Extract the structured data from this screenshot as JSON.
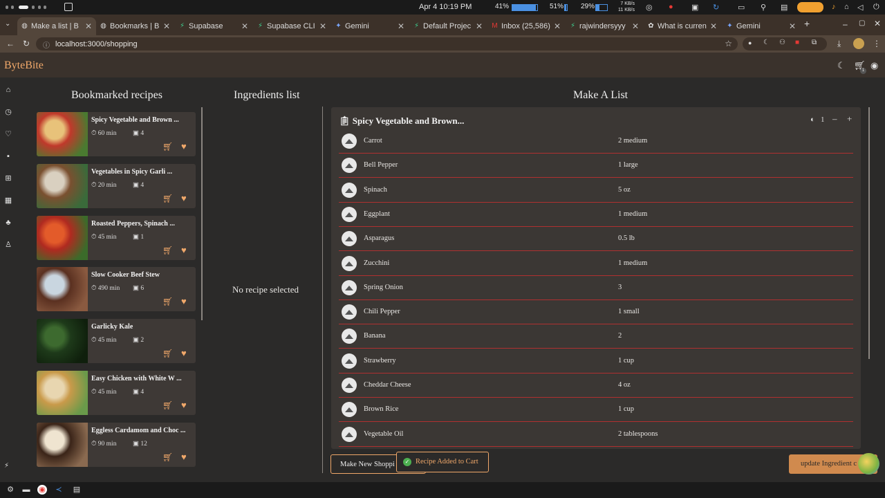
{
  "system": {
    "clock": "Apr 4  10:19 PM",
    "stats": [
      {
        "label": "41%",
        "fill": 0.95
      },
      {
        "label": "51%",
        "fill": 0.5
      },
      {
        "label": "29%",
        "fill": 0.3
      }
    ],
    "net_up": "7 KB/s",
    "net_down": "11 KB/s"
  },
  "tabs": [
    {
      "label": "Make a list | B",
      "icon": "globe-icon",
      "active": true
    },
    {
      "label": "Bookmarks | B",
      "icon": "globe-icon",
      "active": false
    },
    {
      "label": "Supabase",
      "icon": "supabase-icon",
      "active": false
    },
    {
      "label": "Supabase CLI",
      "icon": "supabase-icon",
      "active": false
    },
    {
      "label": "Gemini",
      "icon": "gemini-icon",
      "active": false
    },
    {
      "label": "Default Projec",
      "icon": "supabase-icon",
      "active": false
    },
    {
      "label": "Inbox (25,586)",
      "icon": "gmail-icon",
      "active": false
    },
    {
      "label": "rajwindersyyy",
      "icon": "supabase-icon",
      "active": false
    },
    {
      "label": "What is curren",
      "icon": "chatgpt-icon",
      "active": false
    },
    {
      "label": "Gemini",
      "icon": "gemini-icon",
      "active": false
    }
  ],
  "address": {
    "url": "localhost:3000/shopping"
  },
  "app": {
    "name": "ByteBite",
    "cart_count": "1"
  },
  "headings": {
    "bookmarked": "Bookmarked recipes",
    "ingredients": "Ingredients list",
    "make_list": "Make A List"
  },
  "bookmarks": [
    {
      "title": "Spicy Vegetable and Brown ...",
      "time": "60 min",
      "servings": "4",
      "img": [
        "#c0392b",
        "#e8c27a",
        "#4a7a30"
      ]
    },
    {
      "title": "Vegetables in Spicy Garli ...",
      "time": "20 min",
      "servings": "4",
      "img": [
        "#7a5030",
        "#d9d0c0",
        "#3a6a3a"
      ]
    },
    {
      "title": "Roasted Peppers, Spinach ...",
      "time": "45 min",
      "servings": "1",
      "img": [
        "#b02a20",
        "#e35b2a",
        "#3b6b2a"
      ]
    },
    {
      "title": "Slow Cooker Beef Stew",
      "time": "490 min",
      "servings": "6",
      "img": [
        "#5a3020",
        "#c9d6e0",
        "#8a5a40"
      ]
    },
    {
      "title": "Garlicky Kale",
      "time": "45 min",
      "servings": "2",
      "img": [
        "#1e3a1a",
        "#3d6a2f",
        "#0f1f0c"
      ]
    },
    {
      "title": "Easy Chicken with White W ...",
      "time": "45 min",
      "servings": "4",
      "img": [
        "#c99a4a",
        "#e8d6b0",
        "#6a9a4a"
      ]
    },
    {
      "title": "Eggless Cardamom and Choc ...",
      "time": "90 min",
      "servings": "12",
      "img": [
        "#3a2418",
        "#efe4d0",
        "#8a6a50"
      ]
    }
  ],
  "ingredients_panel": {
    "empty": "No recipe selected"
  },
  "list": {
    "title": "Spicy Vegetable and Brown...",
    "servings": "1",
    "items": [
      {
        "name": "Carrot",
        "qty": "2 medium"
      },
      {
        "name": "Bell Pepper",
        "qty": "1 large"
      },
      {
        "name": "Spinach",
        "qty": "5 oz"
      },
      {
        "name": "Eggplant",
        "qty": "1 medium"
      },
      {
        "name": "Asparagus",
        "qty": "0.5 lb"
      },
      {
        "name": "Zucchini",
        "qty": "1 medium"
      },
      {
        "name": "Spring Onion",
        "qty": "3"
      },
      {
        "name": "Chili Pepper",
        "qty": "1 small"
      },
      {
        "name": "Banana",
        "qty": "2"
      },
      {
        "name": "Strawberry",
        "qty": "1 cup"
      },
      {
        "name": "Cheddar Cheese",
        "qty": "4 oz"
      },
      {
        "name": "Brown Rice",
        "qty": "1 cup"
      },
      {
        "name": "Vegetable Oil",
        "qty": "2 tablespoons"
      }
    ]
  },
  "buttons": {
    "new_list": "Make New Shoppi",
    "update": "update Ingredient c"
  },
  "toast": "Recipe Added to Cart",
  "colors": {
    "accent": "#f0a86a",
    "bg": "#2b2a29",
    "panel": "#3b3734",
    "divider": "#b03030"
  }
}
